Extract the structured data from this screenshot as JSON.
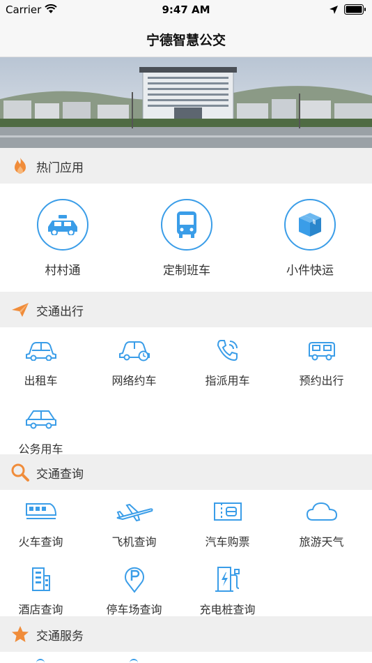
{
  "status_bar": {
    "carrier": "Carrier",
    "time": "9:47 AM"
  },
  "nav": {
    "title": "宁德智慧公交"
  },
  "sections": {
    "hot_apps": {
      "title": "热门应用",
      "items": [
        {
          "label": "村村通",
          "icon": "taxi-icon"
        },
        {
          "label": "定制班车",
          "icon": "bus-icon"
        },
        {
          "label": "小件快运",
          "icon": "package-icon"
        }
      ]
    },
    "transport": {
      "title": "交通出行",
      "items": [
        {
          "label": "出租车",
          "icon": "car-icon"
        },
        {
          "label": "网络约车",
          "icon": "car-clock-icon"
        },
        {
          "label": "指派用车",
          "icon": "phone-icon"
        },
        {
          "label": "预约出行",
          "icon": "van-icon"
        },
        {
          "label": "公务用车",
          "icon": "official-car-icon"
        }
      ]
    },
    "query": {
      "title": "交通查询",
      "items": [
        {
          "label": "火车查询",
          "icon": "train-icon"
        },
        {
          "label": "飞机查询",
          "icon": "plane-icon"
        },
        {
          "label": "汽车购票",
          "icon": "bus-ticket-icon"
        },
        {
          "label": "旅游天气",
          "icon": "cloud-icon"
        },
        {
          "label": "酒店查询",
          "icon": "hotel-icon"
        },
        {
          "label": "停车场查询",
          "icon": "parking-icon"
        },
        {
          "label": "充电桩查询",
          "icon": "charger-icon"
        }
      ]
    },
    "service": {
      "title": "交通服务"
    }
  },
  "colors": {
    "accent": "#3a9de8",
    "header_bg": "#efefef",
    "flame": "#f08c3a"
  }
}
